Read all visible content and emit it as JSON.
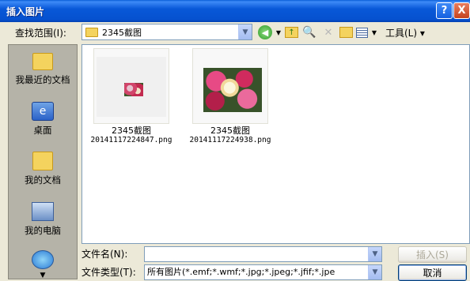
{
  "window": {
    "title": "插入图片",
    "help": "?",
    "close": "X"
  },
  "toolbar": {
    "look_in_label": "查找范围(I):",
    "look_in_value": "2345截图",
    "tools_label": "工具(L)",
    "icons": [
      "back-icon",
      "up-folder-icon",
      "search-web-icon",
      "delete-icon",
      "new-folder-icon",
      "views-icon"
    ]
  },
  "places": [
    {
      "label": "我最近的文档",
      "icon": "recent-docs-icon"
    },
    {
      "label": "桌面",
      "icon": "desktop-icon"
    },
    {
      "label": "我的文档",
      "icon": "my-documents-icon"
    },
    {
      "label": "我的电脑",
      "icon": "my-computer-icon"
    },
    {
      "label": "",
      "icon": "network-icon"
    }
  ],
  "files": [
    {
      "name_line1": "2345截图",
      "name_line2": "20141117224847.png"
    },
    {
      "name_line1": "2345截图",
      "name_line2": "20141117224938.png"
    }
  ],
  "bottom": {
    "filename_label": "文件名(N):",
    "filename_value": "",
    "filetype_label": "文件类型(T):",
    "filetype_value": "所有图片(*.emf;*.wmf;*.jpg;*.jpeg;*.jfif;*.jpe",
    "insert_button": "插入(S)",
    "cancel_button": "取消"
  }
}
